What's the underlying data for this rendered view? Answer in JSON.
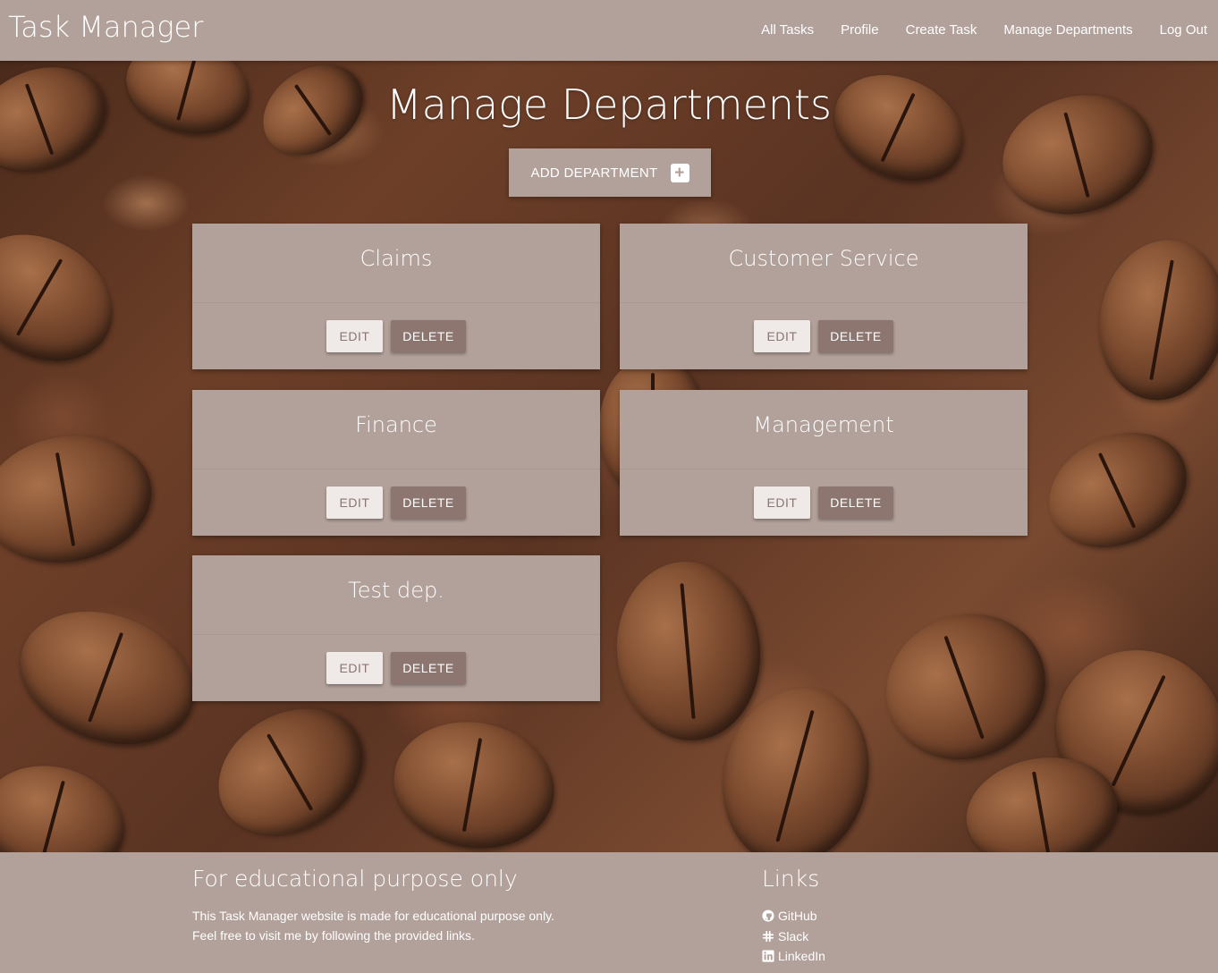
{
  "navbar": {
    "brand": "Task Manager",
    "links": [
      "All Tasks",
      "Profile",
      "Create Task",
      "Manage Departments",
      "Log Out"
    ]
  },
  "main": {
    "title": "Manage Departments",
    "add_button_label": "ADD DEPARTMENT",
    "add_button_icon": "plus-square-icon",
    "departments": [
      {
        "name": "Claims",
        "edit_label": "EDIT",
        "delete_label": "DELETE"
      },
      {
        "name": "Customer Service",
        "edit_label": "EDIT",
        "delete_label": "DELETE"
      },
      {
        "name": "Finance",
        "edit_label": "EDIT",
        "delete_label": "DELETE"
      },
      {
        "name": "Management",
        "edit_label": "EDIT",
        "delete_label": "DELETE"
      },
      {
        "name": "Test dep.",
        "edit_label": "EDIT",
        "delete_label": "DELETE"
      }
    ]
  },
  "footer": {
    "left_heading": "For educational purpose only",
    "left_lines": [
      "This Task Manager website is made for educational purpose only.",
      "Feel free to visit me by following the provided links."
    ],
    "right_heading": "Links",
    "links": [
      {
        "label": "GitHub",
        "icon": "github-icon"
      },
      {
        "label": "Slack",
        "icon": "slack-icon"
      },
      {
        "label": "LinkedIn",
        "icon": "linkedin-icon"
      }
    ]
  },
  "colors": {
    "primary": "#b2a09a",
    "delete_button": "#8d7670",
    "edit_button": "#efe9e7",
    "text": "#ffffff"
  }
}
